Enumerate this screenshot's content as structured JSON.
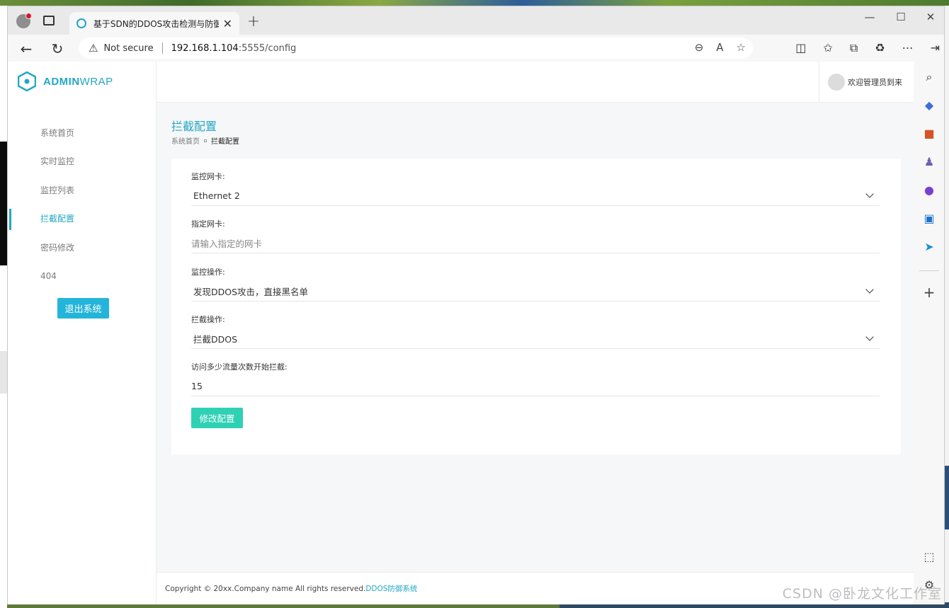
{
  "browser": {
    "tab_title": "基于SDN的DDOS攻击检测与防御",
    "security_label": "Not secure",
    "url_host": "192.168.1.104",
    "url_rest": ":5555/config"
  },
  "app": {
    "logo_bold": "ADMIN",
    "logo_light": "WRAP",
    "welcome": "欢迎管理员到来",
    "page_title": "拦截配置",
    "breadcrumb": [
      "系统首页",
      "拦截配置"
    ],
    "menu": [
      {
        "label": "系统首页",
        "active": false
      },
      {
        "label": "实时监控",
        "active": false
      },
      {
        "label": "监控列表",
        "active": false
      },
      {
        "label": "拦截配置",
        "active": true
      },
      {
        "label": "密码修改",
        "active": false
      },
      {
        "label": "404",
        "active": false
      }
    ],
    "logout_label": "退出系统"
  },
  "form": {
    "nic": {
      "label": "监控网卡:",
      "value": "Ethernet 2"
    },
    "assign_nic": {
      "label": "指定网卡:",
      "placeholder": "请输入指定的网卡"
    },
    "monitor_op": {
      "label": "监控操作:",
      "value": "发现DDOS攻击，直接黑名单"
    },
    "block_op": {
      "label": "拦截操作:",
      "value": "拦截DDOS"
    },
    "threshold": {
      "label": "访问多少流量次数开始拦截:",
      "value": "15"
    },
    "submit_label": "修改配置"
  },
  "footer": {
    "text": "Copyright © 20xx.Company name All rights reserved.",
    "link": "DDOS防御系统"
  },
  "watermark": "CSDN @卧龙文化工作室",
  "colors": {
    "accent": "#23a7c4",
    "submit": "#2fd1b5",
    "logout": "#23b5d9"
  }
}
